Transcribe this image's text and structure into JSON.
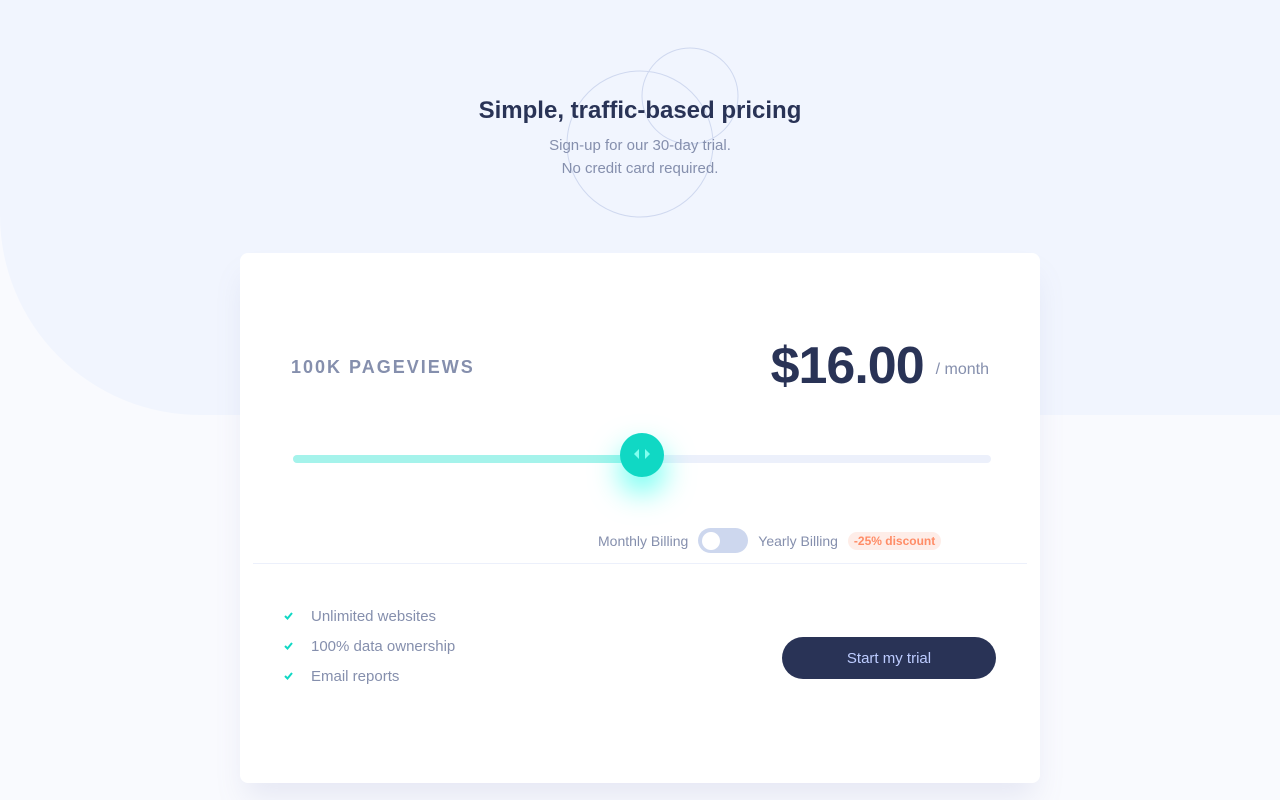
{
  "header": {
    "title": "Simple, traffic-based pricing",
    "subtitle_line1": "Sign-up for our 30-day trial.",
    "subtitle_line2": "No credit card required."
  },
  "pricing": {
    "pageviews": "100K PAGEVIEWS",
    "price": "$16.00",
    "period": "/ month"
  },
  "slider": {
    "value_fraction": 0.5,
    "thumb_icon": "chevrons-left-right-icon"
  },
  "billing": {
    "monthly_label": "Monthly Billing",
    "yearly_label": "Yearly Billing",
    "discount_label": "-25% discount",
    "yearly_selected": false
  },
  "features": [
    {
      "label": "Unlimited websites",
      "icon": "check-icon"
    },
    {
      "label": "100% data ownership",
      "icon": "check-icon"
    },
    {
      "label": "Email reports",
      "icon": "check-icon"
    }
  ],
  "cta": {
    "label": "Start my trial"
  },
  "colors": {
    "accent": "#10d8c4",
    "accent_light": "#a5f3eb",
    "dark": "#293356",
    "text": "#858fad",
    "discount_text": "#ff8c66",
    "discount_bg": "#feede8"
  }
}
